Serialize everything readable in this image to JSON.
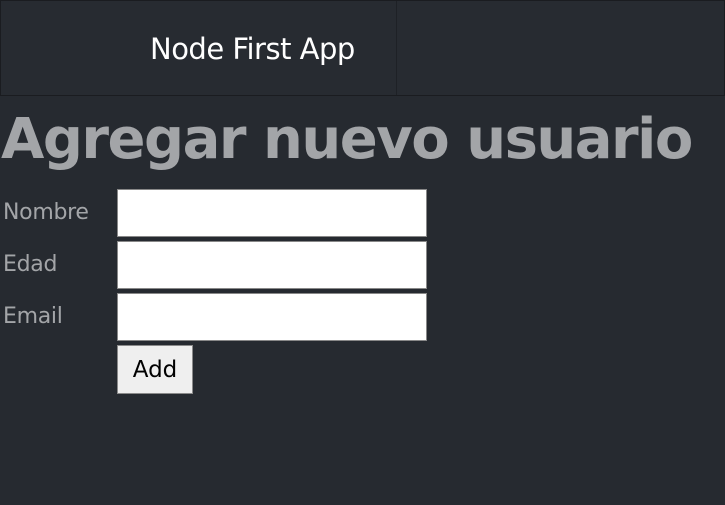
{
  "header": {
    "app_title": "Node First App"
  },
  "main": {
    "page_title": "Agregar nuevo usuario",
    "form": {
      "fields": [
        {
          "label": "Nombre",
          "value": "",
          "placeholder": ""
        },
        {
          "label": "Edad",
          "value": "",
          "placeholder": ""
        },
        {
          "label": "Email",
          "value": "",
          "placeholder": ""
        }
      ],
      "submit_label": "Add"
    }
  },
  "colors": {
    "background": "#262a30",
    "header_text": "#ffffff",
    "muted_text": "#a3a5a8",
    "input_background": "#ffffff",
    "button_background": "#efefef"
  }
}
